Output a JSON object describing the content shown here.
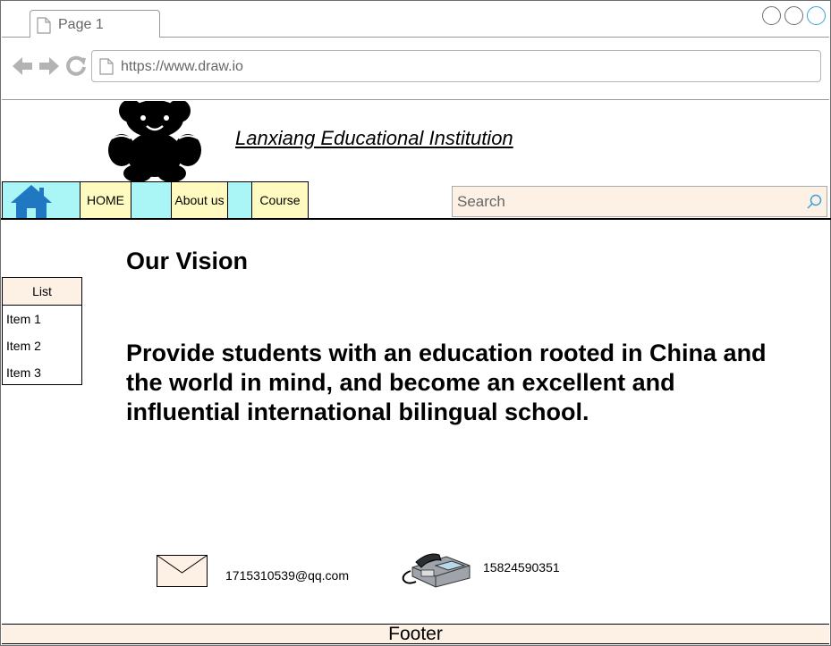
{
  "browser": {
    "tab_label": "Page 1",
    "url": "https://www.draw.io"
  },
  "header": {
    "site_title": "Lanxiang Educational Institution"
  },
  "menu": {
    "home": "HOME",
    "about": "About us",
    "course": "Course"
  },
  "search": {
    "placeholder": "Search"
  },
  "list": {
    "header": "List",
    "items": [
      "Item 1",
      "Item 2",
      "Item 3"
    ]
  },
  "main": {
    "vision_title": "Our Vision",
    "vision_text": "Provide students with an education rooted in China and the world in mind, and become an excellent and influential international bilingual school."
  },
  "contact": {
    "email": "1715310539@qq.com",
    "phone": "15824590351"
  },
  "footer": {
    "label": "Footer"
  },
  "colors": {
    "menubar": "#aaf5f5",
    "menu_button": "#fffbc0",
    "panel": "#fdf1e6",
    "home_icon": "#1f78c1",
    "accent_circle": "#3aa0e0"
  },
  "icons": [
    "page-icon",
    "back-arrow-icon",
    "forward-arrow-icon",
    "reload-icon",
    "teddy-bear-logo",
    "home-icon",
    "search-icon",
    "mail-icon",
    "telephone-icon"
  ]
}
